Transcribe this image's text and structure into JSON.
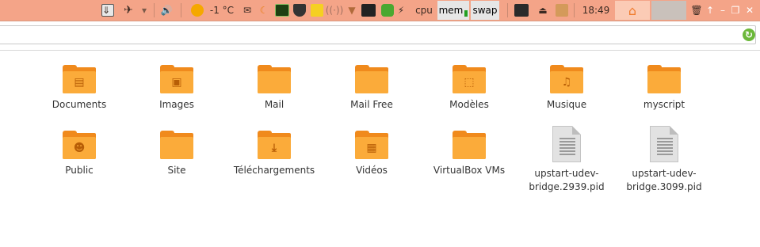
{
  "panel": {
    "weather": "-1 °C",
    "cpu_label": "cpu",
    "mem_label": "mem",
    "swap_label": "swap",
    "clock": "18:49",
    "icons": [
      "download-icon",
      "network-app-icon",
      "dropdown-arrow-icon",
      "volume-icon",
      "weather-sun-icon",
      "mail-icon",
      "moon-icon",
      "system-monitor-icon",
      "shield-icon",
      "sticky-note-icon",
      "wireless-icon",
      "wifi-icon",
      "terminal-icon",
      "app-icon",
      "power-bolt-icon",
      "display-icon",
      "usb-drive-icon",
      "package-icon",
      "home-icon",
      "trash-icon",
      "up-arrow-icon",
      "minimize-icon",
      "restore-icon",
      "close-icon"
    ],
    "colors": {
      "panel": "#f4a488",
      "home_tab": "#fbcbb5",
      "gray_tab": "#c9c1bb",
      "folder": "#fbab3a",
      "folder_dark": "#f08a1c",
      "refresh": "#6cb83a"
    }
  },
  "files": [
    {
      "name": "Documents",
      "type": "folder",
      "emblem": "document-icon"
    },
    {
      "name": "Images",
      "type": "folder",
      "emblem": "image-icon"
    },
    {
      "name": "Mail",
      "type": "folder",
      "emblem": ""
    },
    {
      "name": "Mail Free",
      "type": "folder",
      "emblem": ""
    },
    {
      "name": "Modèles",
      "type": "folder",
      "emblem": "template-icon"
    },
    {
      "name": "Musique",
      "type": "folder",
      "emblem": "music-icon"
    },
    {
      "name": "myscript",
      "type": "folder",
      "emblem": ""
    },
    {
      "name": "Public",
      "type": "folder",
      "emblem": "people-icon"
    },
    {
      "name": "Site",
      "type": "folder",
      "emblem": ""
    },
    {
      "name": "Téléchargements",
      "type": "folder",
      "emblem": "download-icon"
    },
    {
      "name": "Vidéos",
      "type": "folder",
      "emblem": "film-icon"
    },
    {
      "name": "VirtualBox VMs",
      "type": "folder",
      "emblem": ""
    },
    {
      "name": "upstart-udev-bridge.2939.pid",
      "type": "file",
      "lines": [
        "upstart-udev-",
        "bridge.2939.pid"
      ]
    },
    {
      "name": "upstart-udev-bridge.3099.pid",
      "type": "file",
      "lines": [
        "upstart-udev-",
        "bridge.3099.pid"
      ]
    }
  ]
}
